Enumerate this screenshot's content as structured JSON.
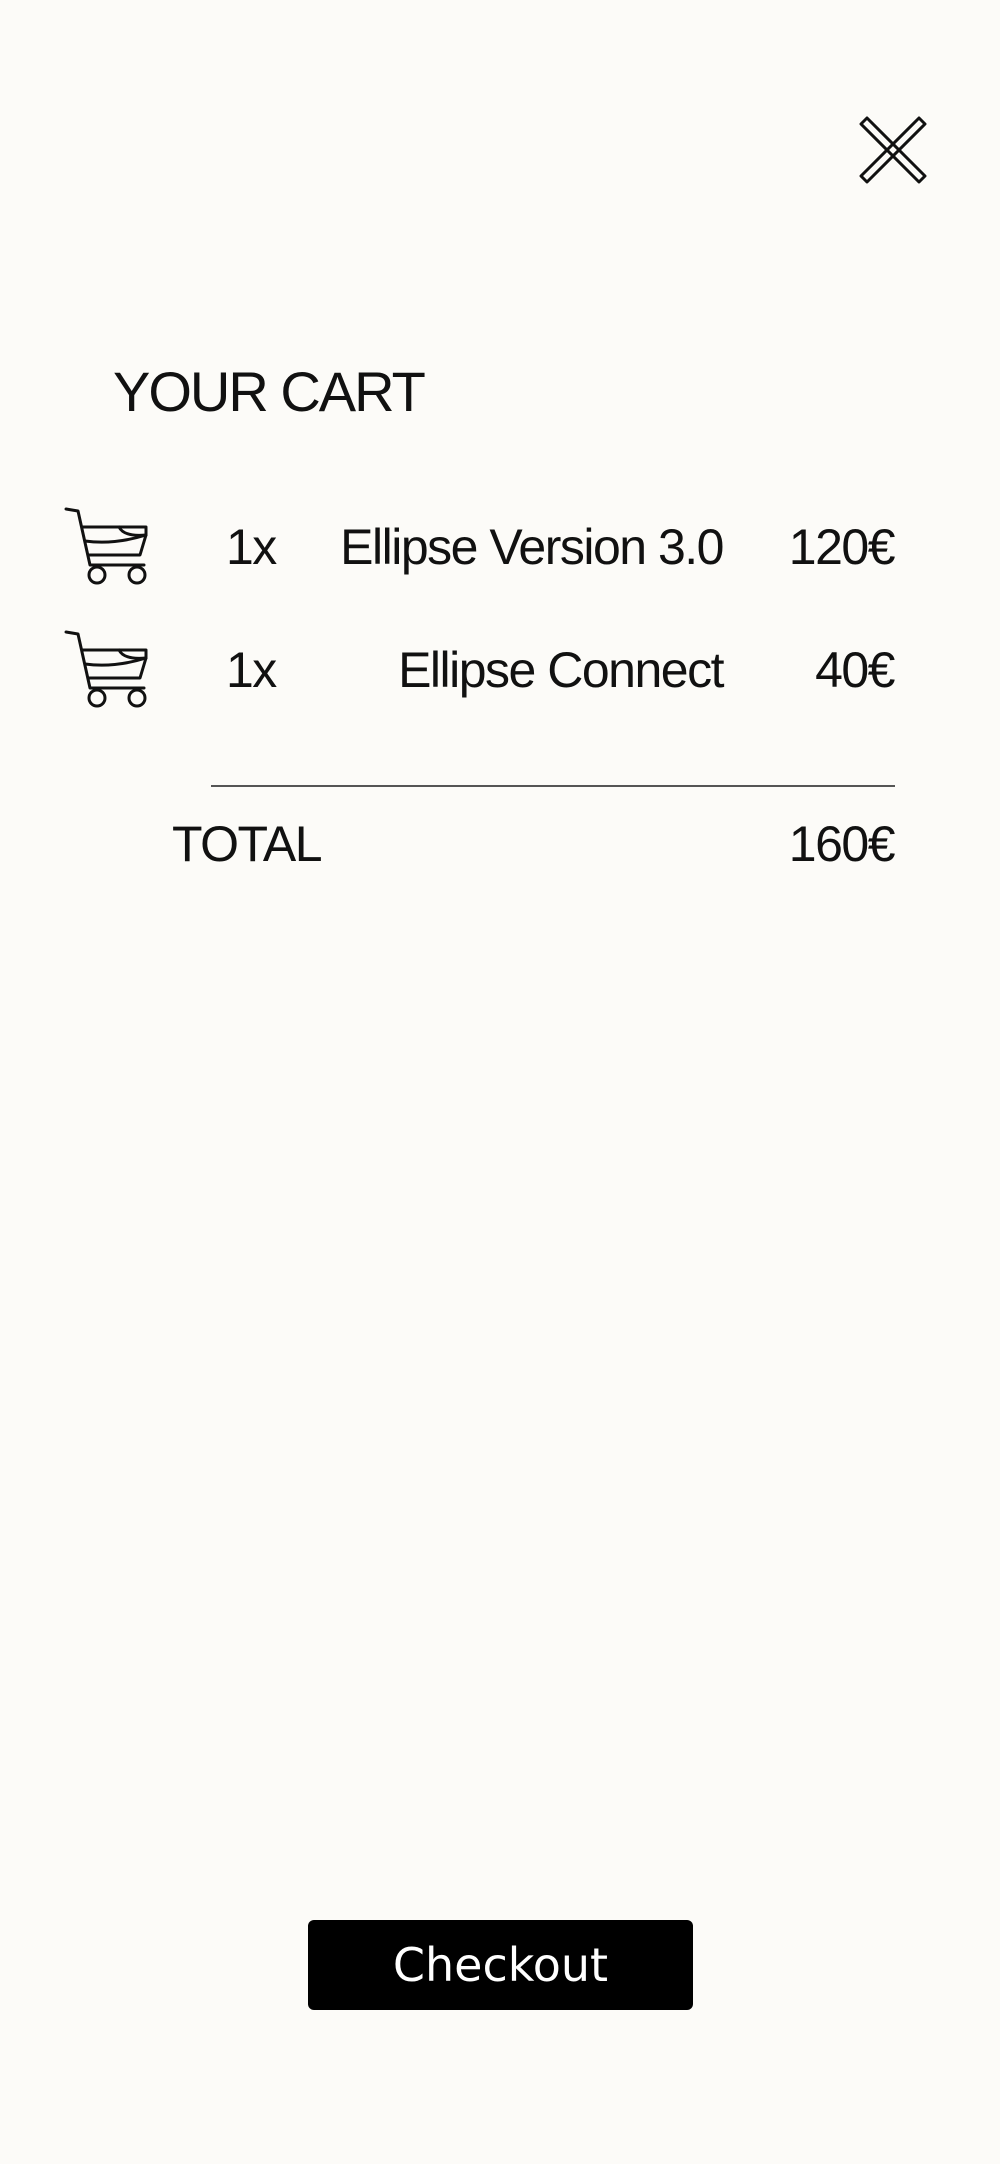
{
  "header": {
    "close_icon": "close-icon"
  },
  "cart": {
    "title": "YOUR CART",
    "items": [
      {
        "icon": "shopping-cart-icon",
        "quantity": "1x",
        "name": "Ellipse Version 3.0",
        "price": "120€"
      },
      {
        "icon": "shopping-cart-icon",
        "quantity": "1x",
        "name": "Ellipse Connect",
        "price": "40€"
      }
    ],
    "total_label": "TOTAL",
    "total_value": "160€"
  },
  "checkout": {
    "label": "Checkout"
  },
  "colors": {
    "background": "#fcfbf8",
    "text": "#111111",
    "button_background": "#000000",
    "button_text": "#ffffff",
    "divider": "#555555"
  }
}
